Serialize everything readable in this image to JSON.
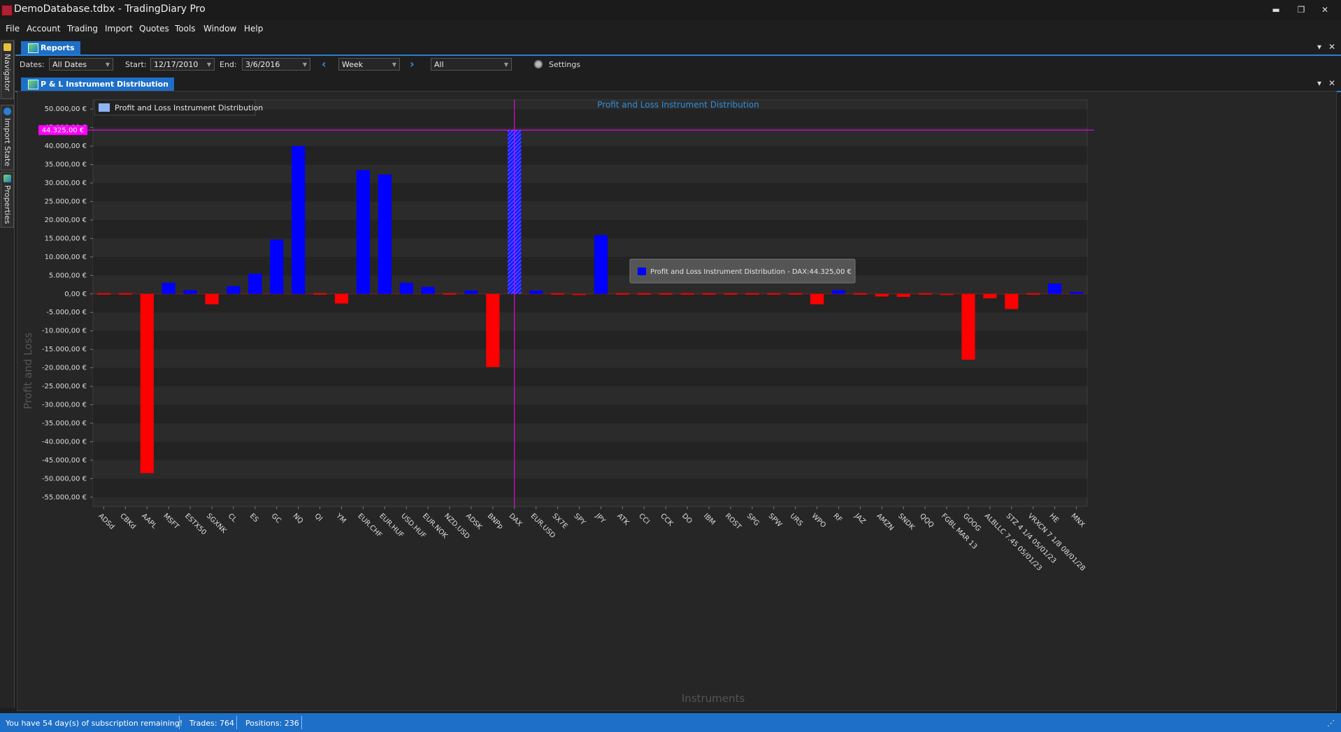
{
  "window": {
    "title": "DemoDatabase.tdbx - TradingDiary Pro",
    "minimize": "▬",
    "restore": "❐",
    "close": "✕"
  },
  "menu": [
    "File",
    "Account",
    "Trading",
    "Import",
    "Quotes",
    "Tools",
    "Window",
    "Help"
  ],
  "side_tabs": [
    "Navigator",
    "Import State",
    "Properties"
  ],
  "reports_tab": {
    "label": "Reports"
  },
  "toolbar": {
    "dates_label": "Dates:",
    "dates_value": "All Dates",
    "start_label": "Start:",
    "start_value": "12/17/2010",
    "end_label": "End:",
    "end_value": "3/6/2016",
    "period_value": "Week",
    "filter_value": "All",
    "settings_label": "Settings",
    "prev_icon": "chevron-left",
    "next_icon": "chevron-right"
  },
  "report_tab": {
    "label": "P & L Instrument Distribution"
  },
  "tab_controls": {
    "menu": "▾",
    "close": "✕"
  },
  "chart_data": {
    "type": "bar",
    "title": "Profit and Loss Instrument Distribution",
    "xlabel": "Instruments",
    "ylabel": "Profit and Loss",
    "legend": {
      "label": "Profit and Loss Instrument Distribution",
      "placement": "top-left"
    },
    "ylim": [
      -57500,
      52500
    ],
    "yticks": [
      50000,
      45000,
      40000,
      35000,
      30000,
      25000,
      20000,
      15000,
      10000,
      5000,
      0,
      -5000,
      -10000,
      -15000,
      -20000,
      -25000,
      -30000,
      -35000,
      -40000,
      -45000,
      -50000,
      -55000
    ],
    "ytick_labels": [
      "50.000,00 €",
      "45.000,00 €",
      "40.000,00 €",
      "35.000,00 €",
      "30.000,00 €",
      "25.000,00 €",
      "20.000,00 €",
      "15.000,00 €",
      "10.000,00 €",
      "5.000,00 €",
      "0,00 €",
      "-5.000,00 €",
      "-10.000,00 €",
      "-15.000,00 €",
      "-20.000,00 €",
      "-25.000,00 €",
      "-30.000,00 €",
      "-35.000,00 €",
      "-40.000,00 €",
      "-45.000,00 €",
      "-50.000,00 €",
      "-55.000,00 €"
    ],
    "categories": [
      "ADSd",
      "CBKd",
      "AAPL",
      "MSFT",
      "ESTX50",
      "SGXNK",
      "CL",
      "ES",
      "GC",
      "NQ",
      "QI",
      "YM",
      "EUR.CHF",
      "EUR.HUF",
      "USD.HUF",
      "EUR.NOK",
      "NZD.USD",
      "ADSK",
      "BNPp",
      "DAX",
      "EUR.USD",
      "SX7E",
      "SPY",
      "JPY",
      "ATK",
      "CCI",
      "CCK",
      "DO",
      "IBM",
      "ROST",
      "SPG",
      "SPW",
      "URS",
      "WPO",
      "RF",
      "JAZ",
      "AMZN",
      "SNDK",
      "QQQ",
      "FGBL MAR 13",
      "GOOG",
      "ALBLLC 7.45 05/01/23",
      "STZ 4 1/4 05/01/23",
      "VRXCN 7 1/8 08/01/28",
      "HE",
      "MNX"
    ],
    "values": [
      -200,
      -100,
      -48500,
      3000,
      1000,
      -2800,
      2100,
      5500,
      14700,
      40000,
      -100,
      -2600,
      33500,
      32300,
      3000,
      1900,
      -200,
      900,
      -19800,
      44325,
      900,
      -100,
      -300,
      15900,
      -100,
      -50,
      -50,
      -150,
      -150,
      -150,
      -50,
      -50,
      -150,
      -2800,
      1000,
      -150,
      -700,
      -800,
      -150,
      -300,
      -17800,
      -1200,
      -4100,
      -200,
      2800,
      500
    ],
    "highlight": {
      "category": "DAX",
      "value_label": "44.325,00 €",
      "tooltip": "Profit and Loss Instrument Distribution - DAX:44.325,00 €"
    },
    "colors": {
      "positive": "#0000ff",
      "negative": "#ff0000",
      "crosshair": "#ff00ff",
      "legend_swatch": "#8fb4f4",
      "title": "#2f8fdc"
    },
    "grid": "alternating bands"
  },
  "status": {
    "subscription": "You have 54 day(s) of subscription remaining!",
    "trades": "Trades: 764",
    "positions": "Positions: 236"
  }
}
